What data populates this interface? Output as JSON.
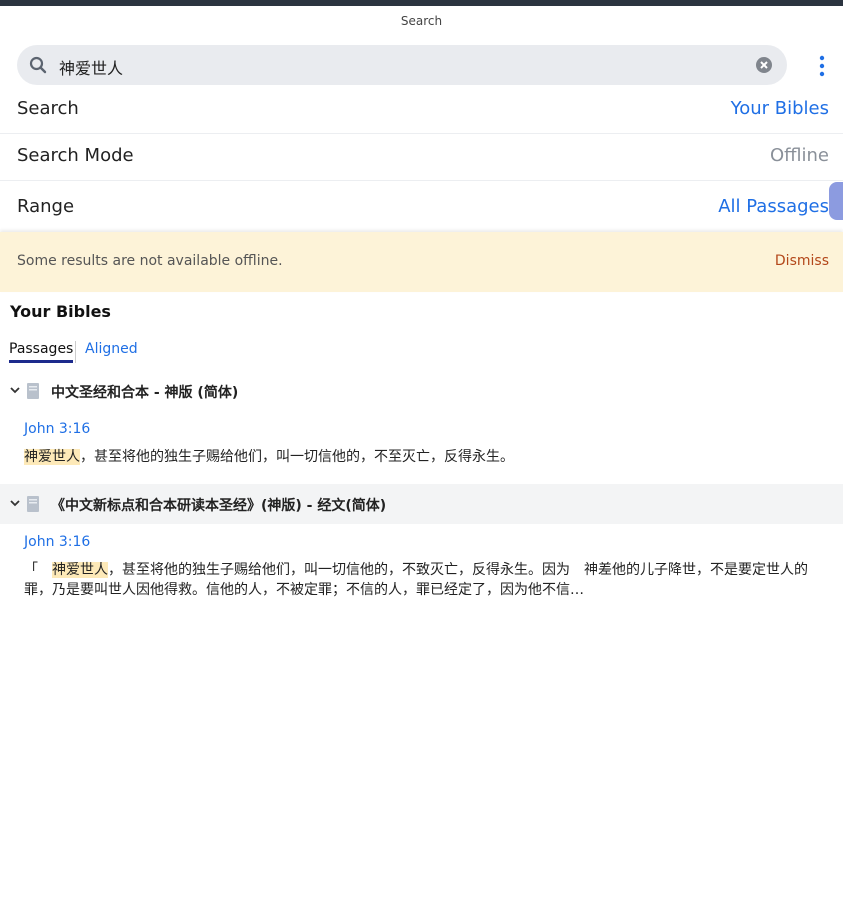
{
  "header": {
    "title": "Search"
  },
  "search": {
    "query": "神爱世人"
  },
  "settings": {
    "search": {
      "label": "Search",
      "value": "Your Bibles"
    },
    "mode": {
      "label": "Search Mode",
      "value": "Offline"
    },
    "range": {
      "label": "Range",
      "value": "All Passages"
    }
  },
  "banner": {
    "message": "Some results are not available offline.",
    "dismiss": "Dismiss"
  },
  "results": {
    "section_title": "Your Bibles",
    "tabs": [
      "Passages",
      "Aligned"
    ],
    "groups": [
      {
        "title": "中文圣经和合本 - 神版 (简体)",
        "reference": "John 3:16",
        "highlight": "神爱世人",
        "text": "，甚至将他的独生子赐给他们，叫一切信他的，不至灭亡，反得永生。"
      },
      {
        "title": "《中文新标点和合本研读本圣经》(神版) - 经文(简体)",
        "reference": "John 3:16",
        "prefix": "「　",
        "highlight": "神爱世人",
        "text": "，甚至将他的独生子赐给他们，叫一切信他的，不致灭亡，反得永生。因为　神差他的儿子降世，不是要定世人的罪，乃是要叫世人因他得救。信他的人，不被定罪；不信的人，罪已经定了，因为他不信…"
      }
    ]
  },
  "colors": {
    "accent": "#1f6fe5",
    "banner_bg": "#fdf3d8",
    "highlight": "#fde9b8",
    "dismiss": "#b3471a"
  }
}
